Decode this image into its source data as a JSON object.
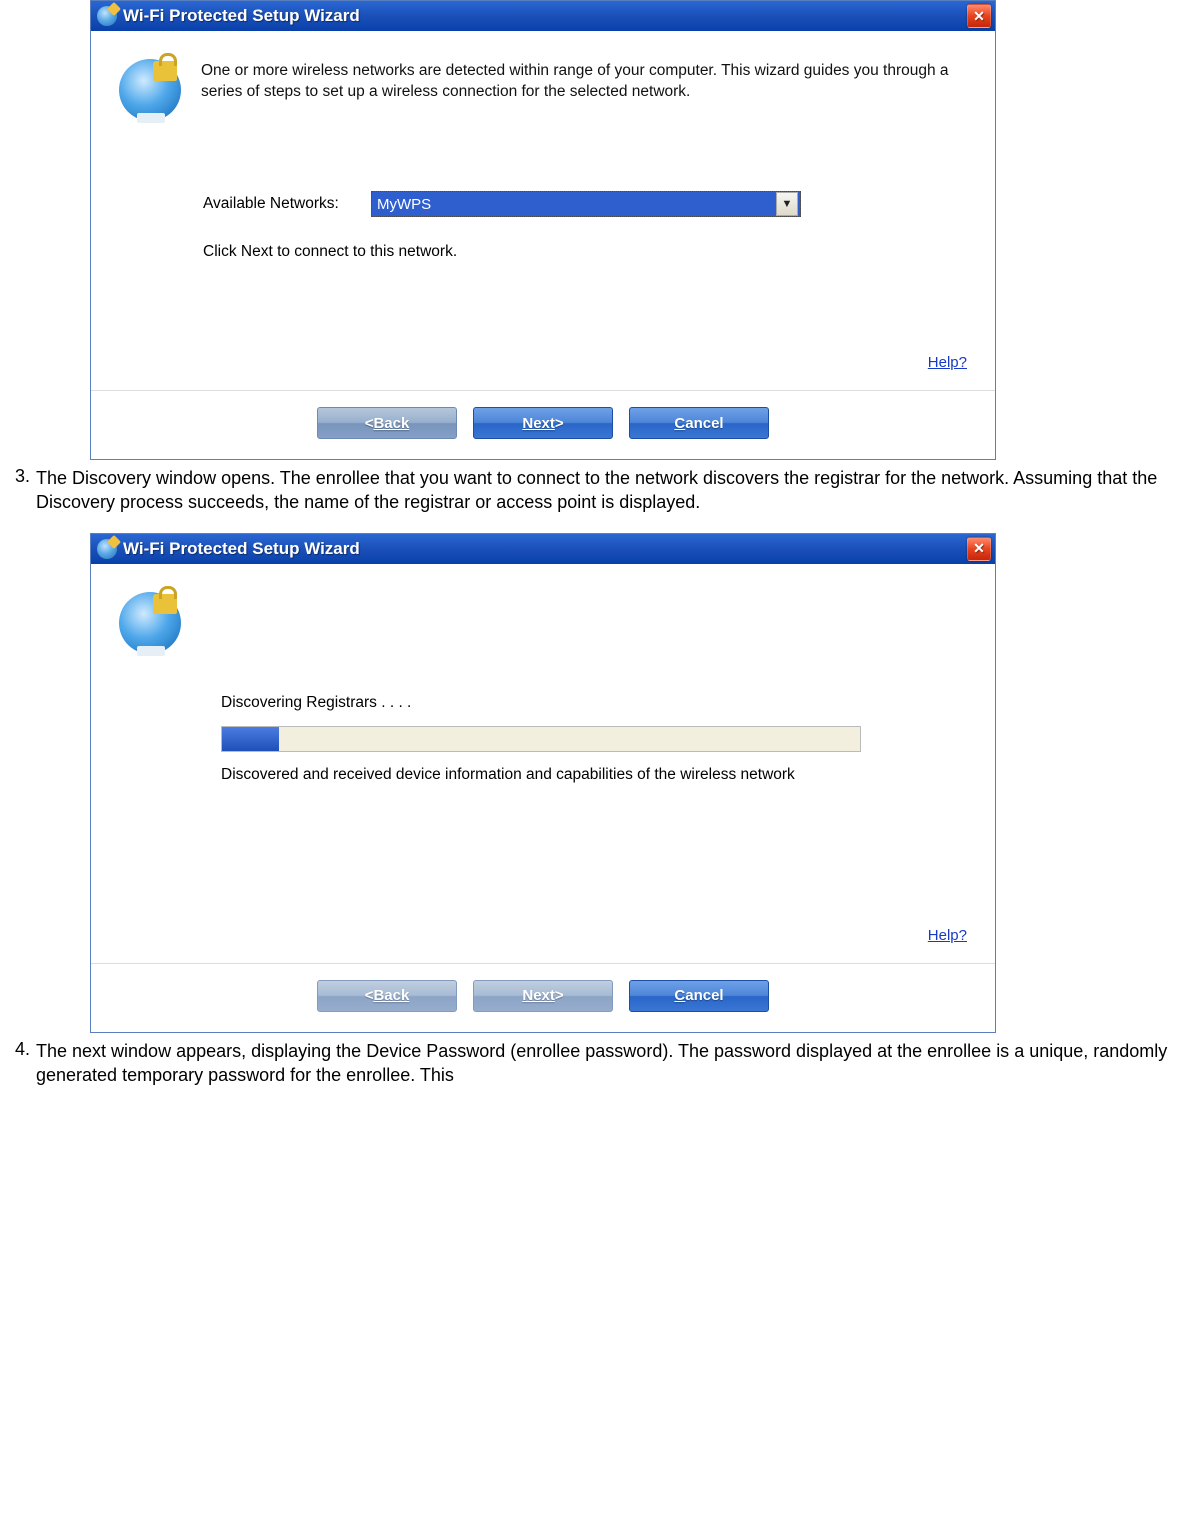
{
  "steps": {
    "s3_num": "3.",
    "s3_text": "The Discovery window opens. The enrollee that you want to connect to the network discovers the registrar for the network. Assuming that the Discovery process succeeds, the name of the registrar or access point is displayed.",
    "s4_num": "4.",
    "s4_text": "The next window appears, displaying the Device Password (enrollee password). The password displayed at the enrollee is a unique, randomly generated temporary password for the enrollee. This"
  },
  "dialog1": {
    "title": "Wi-Fi Protected Setup Wizard",
    "intro": "One or more wireless networks are detected within range of your computer. This wizard guides you through a series of steps to set up a wireless connection for the selected network.",
    "available_label": "Available Networks:",
    "selected_network": "MyWPS",
    "hint": "Click Next to connect to this network.",
    "help": "Help?",
    "back": "Back",
    "next": "Next",
    "cancel": "Cancel"
  },
  "dialog2": {
    "title": "Wi-Fi Protected Setup Wizard",
    "discovering": "Discovering Registrars . . . .",
    "status": "Discovered and received device information and capabilities of the wireless network",
    "progress_percent": 9,
    "help": "Help?",
    "back": "Back",
    "next": "Next",
    "cancel": "Cancel"
  }
}
